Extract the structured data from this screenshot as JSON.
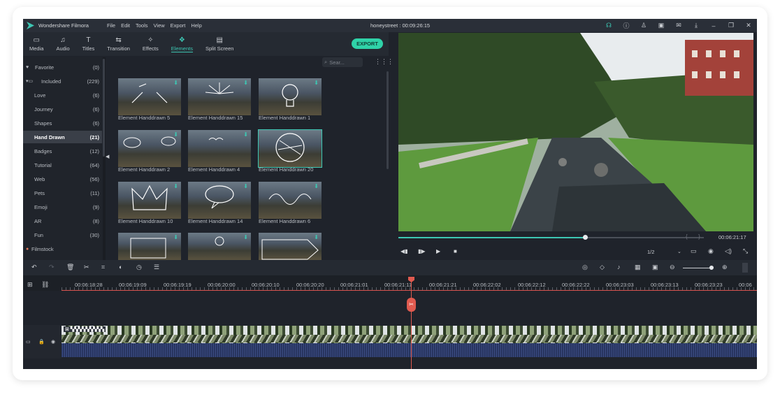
{
  "app": {
    "name": "Wondershare Filmora",
    "menu": [
      "File",
      "Edit",
      "Tools",
      "View",
      "Export",
      "Help"
    ],
    "project_title": "honeystreet : 00:09:26:15",
    "window_icons": [
      "support-icon",
      "info-icon",
      "account-icon",
      "save-icon",
      "mail-icon",
      "download-icon",
      "minimize-icon",
      "restore-icon",
      "close-icon"
    ]
  },
  "toolbar": {
    "tabs": [
      {
        "label": "Media",
        "icon": "▭"
      },
      {
        "label": "Audio",
        "icon": "♫"
      },
      {
        "label": "Titles",
        "icon": "T"
      },
      {
        "label": "Transition",
        "icon": "⇆"
      },
      {
        "label": "Effects",
        "icon": "✧"
      },
      {
        "label": "Elements",
        "icon": "❖"
      },
      {
        "label": "Split Screen",
        "icon": "▤"
      }
    ],
    "active_tab": "Elements",
    "export_label": "EXPORT"
  },
  "sidebar": {
    "favorite": {
      "label": "Favorite",
      "count": "(0)"
    },
    "included": {
      "label": "Included",
      "count": "(229)"
    },
    "items": [
      {
        "label": "Love",
        "count": "(6)"
      },
      {
        "label": "Journey",
        "count": "(6)"
      },
      {
        "label": "Shapes",
        "count": "(6)"
      },
      {
        "label": "Hand Drawn",
        "count": "(21)"
      },
      {
        "label": "Badges",
        "count": "(12)"
      },
      {
        "label": "Tutorial",
        "count": "(64)"
      },
      {
        "label": "Web",
        "count": "(56)"
      },
      {
        "label": "Pets",
        "count": "(11)"
      },
      {
        "label": "Emoji",
        "count": "(9)"
      },
      {
        "label": "AR",
        "count": "(8)"
      },
      {
        "label": "Fun",
        "count": "(30)"
      }
    ],
    "selected": "Hand Drawn",
    "filmstock": "Filmstock"
  },
  "search": {
    "placeholder": "Sear..."
  },
  "elements": [
    {
      "caption": "Element Handdrawn 5"
    },
    {
      "caption": "Element Handdrawn 15"
    },
    {
      "caption": "Element Handdrawn 1"
    },
    {
      "caption": "Element Handdrawn 2"
    },
    {
      "caption": "Element Handdrawn 4"
    },
    {
      "caption": "Element Handdrawn 20"
    },
    {
      "caption": "Element Handdrawn 10"
    },
    {
      "caption": "Element Handdrawn 14"
    },
    {
      "caption": "Element Handdrawn 6"
    }
  ],
  "player": {
    "progress": 0.61,
    "time": "00:06:21:17",
    "ratio": "1/2",
    "bracket_in": "{",
    "bracket_out": "}"
  },
  "timeline": {
    "ruler_labels": [
      "00:06:18:28",
      "00:06:19:09",
      "00:06:19:19",
      "00:06:20:00",
      "00:06:20:10",
      "00:06:20:20",
      "00:06:21:01",
      "00:06:21:11",
      "00:06:21:21",
      "00:06:22:02",
      "00:06:22:12",
      "00:06:22:22",
      "00:06:23:03",
      "00:06:23:13",
      "00:06:23:23",
      "00:06"
    ],
    "clip_label": "⊠ ▚▚▚▚▚▚▚▚▚"
  },
  "colors": {
    "accent": "#3dc7b3",
    "playhead": "#e05a4f",
    "export": "#2fd2a8"
  }
}
